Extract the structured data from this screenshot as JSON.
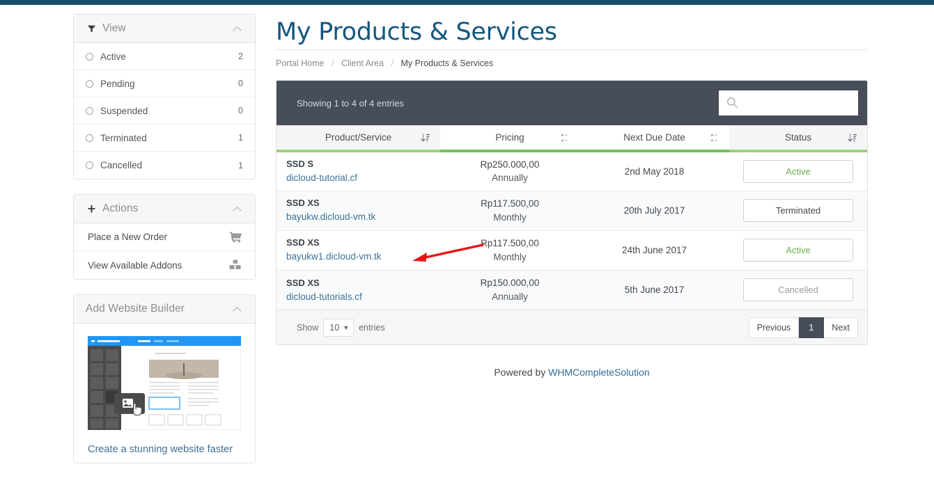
{
  "theme": {
    "topbar_color": "#17506e",
    "title_color": "#14567d",
    "table_header_bg": "#474d59",
    "accent_green": "#73c054",
    "status_active_color": "#6aae4f",
    "status_terminated_color": "#43484d",
    "status_cancelled_color": "#9b9b9b",
    "annotation_arrow_color": "#e61414"
  },
  "header": {
    "title": "My Products & Services"
  },
  "breadcrumb": {
    "items": [
      {
        "label": "Portal Home",
        "current": false
      },
      {
        "label": "Client Area",
        "current": false
      },
      {
        "label": "My Products & Services",
        "current": true
      }
    ],
    "separator": "/"
  },
  "sidebar": {
    "view_panel": {
      "title": "View",
      "icon": "filter-funnel-icon",
      "collapse_icon": "chevron-up-icon",
      "items": [
        {
          "label": "Active",
          "count": "2",
          "icon": "circle-icon"
        },
        {
          "label": "Pending",
          "count": "0",
          "icon": "circle-icon"
        },
        {
          "label": "Suspended",
          "count": "0",
          "icon": "circle-icon"
        },
        {
          "label": "Terminated",
          "count": "1",
          "icon": "circle-icon"
        },
        {
          "label": "Cancelled",
          "count": "1",
          "icon": "circle-icon"
        }
      ]
    },
    "actions_panel": {
      "title": "Actions",
      "icon": "plus-icon",
      "collapse_icon": "chevron-up-icon",
      "items": [
        {
          "label": "Place a New Order",
          "icon": "shopping-cart-icon"
        },
        {
          "label": "View Available Addons",
          "icon": "addons-blocks-icon"
        }
      ]
    },
    "website_builder_panel": {
      "title": "Add Website Builder",
      "collapse_icon": "chevron-up-icon",
      "preview_icon": "website-builder-preview-image",
      "caption": "Create a stunning website faster"
    }
  },
  "table": {
    "info": "Showing 1 to 4 of 4 entries",
    "search": {
      "placeholder": "",
      "value": "",
      "icon": "search-icon"
    },
    "columns": [
      {
        "label": "Product/Service",
        "sort_icon": "sort-desc-icon",
        "sorted": true
      },
      {
        "label": "Pricing",
        "sort_icon": "sort-both-icon",
        "sorted": false
      },
      {
        "label": "Next Due Date",
        "sort_icon": "sort-both-icon",
        "sorted": false
      },
      {
        "label": "Status",
        "sort_icon": "sort-desc-icon",
        "sorted": true
      }
    ],
    "rows": [
      {
        "product": "SSD S",
        "domain": "dicloud-tutorial.cf",
        "price_amount": "Rp250.000,00",
        "billing_cycle": "Annually",
        "next_due_date": "2nd May 2018",
        "status": "Active",
        "status_style": "active"
      },
      {
        "product": "SSD XS",
        "domain": "bayukw.dicloud-vm.tk",
        "price_amount": "Rp117.500,00",
        "billing_cycle": "Monthly",
        "next_due_date": "20th July 2017",
        "status": "Terminated",
        "status_style": "terminated"
      },
      {
        "product": "SSD XS",
        "domain": "bayukw1.dicloud-vm.tk",
        "price_amount": "Rp117.500,00",
        "billing_cycle": "Monthly",
        "next_due_date": "24th June 2017",
        "status": "Active",
        "status_style": "active"
      },
      {
        "product": "SSD XS",
        "domain": "dicloud-tutorials.cf",
        "price_amount": "Rp150.000,00",
        "billing_cycle": "Annually",
        "next_due_date": "5th June 2017",
        "status": "Cancelled",
        "status_style": "cancelled"
      }
    ],
    "footer": {
      "show_label": "Show",
      "length_value": "10",
      "entries_label": "entries",
      "pagination": {
        "previous": "Previous",
        "pages": [
          "1"
        ],
        "next": "Next",
        "active_page": "1"
      }
    }
  },
  "footer": {
    "powered_prefix": "Powered by ",
    "powered_link": "WHMCompleteSolution"
  },
  "annotation": {
    "type": "red-arrow",
    "points_to": "bayukw1.dicloud-vm.tk"
  }
}
